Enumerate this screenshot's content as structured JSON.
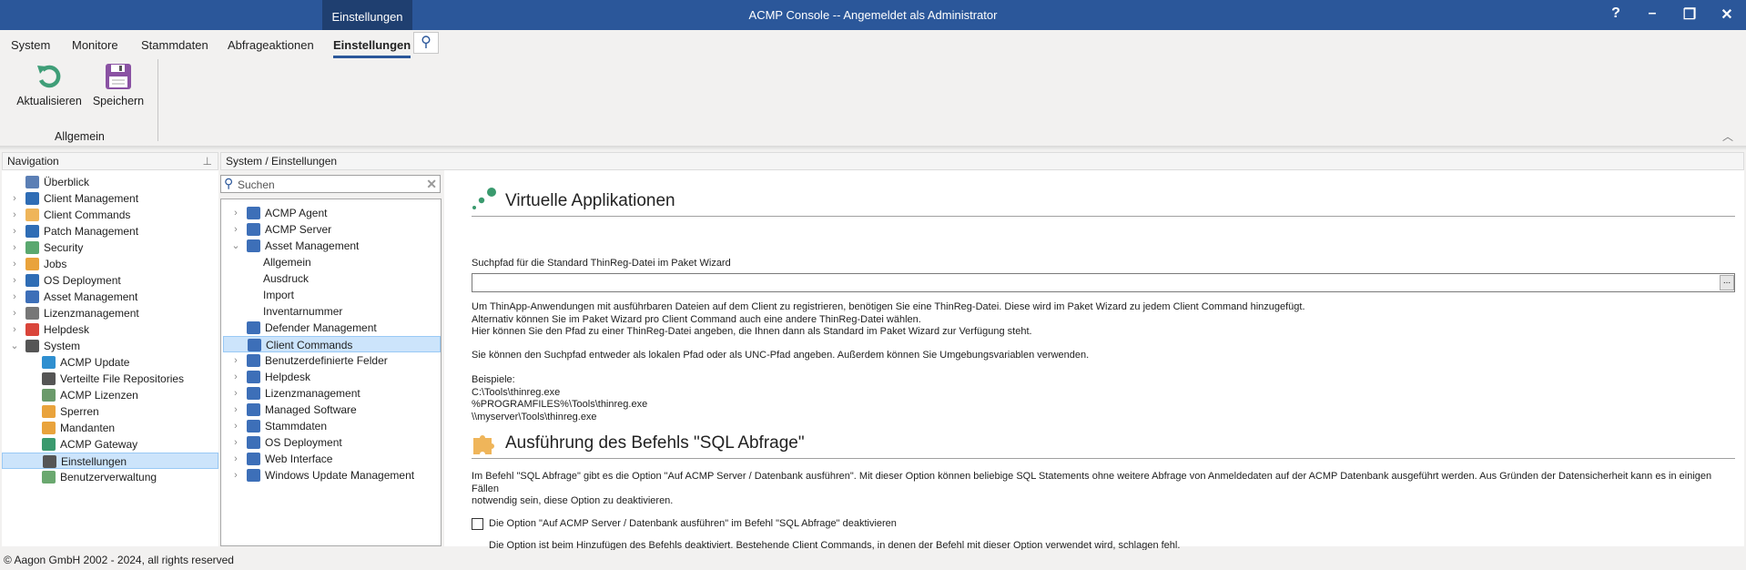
{
  "titlebar": {
    "context_tab": "Einstellungen",
    "title": "ACMP Console -- Angemeldet als Administrator",
    "help": "?",
    "minimize": "–",
    "restore": "❐",
    "close": "✕"
  },
  "ribbon": {
    "tabs": [
      "System",
      "Monitore",
      "Stammdaten",
      "Abfrageaktionen",
      "Einstellungen"
    ],
    "active_tab": "Einstellungen",
    "buttons": {
      "refresh": "Aktualisieren",
      "save": "Speichern"
    },
    "group": "Allgemein"
  },
  "navigation": {
    "title": "Navigation",
    "items": [
      {
        "label": "Überblick",
        "icon": "overview-icon",
        "expandable": false
      },
      {
        "label": "Client Management",
        "icon": "monitor-icon",
        "expandable": true
      },
      {
        "label": "Client Commands",
        "icon": "puzzle-icon",
        "expandable": true
      },
      {
        "label": "Patch Management",
        "icon": "patch-icon",
        "expandable": true
      },
      {
        "label": "Security",
        "icon": "shield-icon",
        "expandable": true
      },
      {
        "label": "Jobs",
        "icon": "clipboard-icon",
        "expandable": true
      },
      {
        "label": "OS Deployment",
        "icon": "deploy-icon",
        "expandable": true
      },
      {
        "label": "Asset Management",
        "icon": "asset-icon",
        "expandable": true
      },
      {
        "label": "Lizenzmanagement",
        "icon": "license-icon",
        "expandable": true
      },
      {
        "label": "Helpdesk",
        "icon": "tag-icon",
        "expandable": true
      },
      {
        "label": "System",
        "icon": "server-icon",
        "expandable": true,
        "expanded": true
      },
      {
        "label": "ACMP Update",
        "icon": "update-icon",
        "child": true
      },
      {
        "label": "Verteilte File Repositories",
        "icon": "repository-icon",
        "child": true
      },
      {
        "label": "ACMP Lizenzen",
        "icon": "certificate-icon",
        "child": true
      },
      {
        "label": "Sperren",
        "icon": "lock-icon",
        "child": true
      },
      {
        "label": "Mandanten",
        "icon": "tenant-icon",
        "child": true
      },
      {
        "label": "ACMP Gateway",
        "icon": "gateway-icon",
        "child": true
      },
      {
        "label": "Einstellungen",
        "icon": "tools-icon",
        "child": true,
        "selected": true
      },
      {
        "label": "Benutzerverwaltung",
        "icon": "users-icon",
        "child": true
      }
    ]
  },
  "settings_tree": {
    "title": "System / Einstellungen",
    "search_placeholder": "Suchen",
    "items": [
      {
        "label": "ACMP Agent",
        "expandable": true
      },
      {
        "label": "ACMP Server",
        "expandable": true
      },
      {
        "label": "Asset Management",
        "expandable": true,
        "expanded": true
      },
      {
        "label": "Allgemein",
        "child": true
      },
      {
        "label": "Ausdruck",
        "child": true
      },
      {
        "label": "Import",
        "child": true
      },
      {
        "label": "Inventarnummer",
        "child": true
      },
      {
        "label": "Defender Management",
        "expandable": false
      },
      {
        "label": "Client Commands",
        "expandable": false,
        "selected": true
      },
      {
        "label": "Benutzerdefinierte Felder",
        "expandable": true
      },
      {
        "label": "Helpdesk",
        "expandable": true
      },
      {
        "label": "Lizenzmanagement",
        "expandable": true
      },
      {
        "label": "Managed Software",
        "expandable": true
      },
      {
        "label": "Stammdaten",
        "expandable": true
      },
      {
        "label": "OS Deployment",
        "expandable": true
      },
      {
        "label": "Web Interface",
        "expandable": true
      },
      {
        "label": "Windows Update Management",
        "expandable": true
      }
    ]
  },
  "content": {
    "virtual": {
      "heading": "Virtuelle Applikationen",
      "field_label": "Suchpfad für die Standard ThinReg-Datei im Paket Wizard",
      "field_value": "",
      "browse": "...",
      "p1": "Um ThinApp-Anwendungen mit ausführbaren Dateien auf dem Client zu registrieren, benötigen Sie eine ThinReg-Datei. Diese wird im Paket Wizard zu jedem Client Command hinzugefügt.",
      "p2": "Alternativ können Sie im Paket Wizard pro Client Command auch eine andere ThinReg-Datei wählen.",
      "p3": "Hier können Sie den Pfad zu einer ThinReg-Datei angeben, die Ihnen dann als Standard im Paket Wizard zur Verfügung steht.",
      "p4": "Sie können den Suchpfad entweder als lokalen Pfad oder als UNC-Pfad angeben. Außerdem können Sie Umgebungsvariablen verwenden.",
      "examples_label": "Beispiele:",
      "examples": [
        "C:\\Tools\\thinreg.exe",
        "%PROGRAMFILES%\\Tools\\thinreg.exe",
        "\\\\myserver\\Tools\\thinreg.exe"
      ]
    },
    "sql": {
      "heading": "Ausführung des Befehls \"SQL Abfrage\"",
      "p1": "Im Befehl \"SQL Abfrage\" gibt es die Option \"Auf ACMP Server / Datenbank ausführen\". Mit dieser Option können beliebige SQL Statements ohne weitere Abfrage von Anmeldedaten auf der ACMP Datenbank ausgeführt werden. Aus Gründen der Datensicherheit kann es in einigen Fällen",
      "p2": "notwendig sein, diese Option zu deaktivieren.",
      "checkbox_label": "Die Option \"Auf ACMP Server / Datenbank ausführen\" im Befehl \"SQL Abfrage\" deaktivieren",
      "checkbox_checked": false,
      "note": "Die Option ist beim Hinzufügen des Befehls deaktiviert. Bestehende Client Commands, in denen der Befehl mit dieser Option verwendet wird, schlagen fehl."
    }
  },
  "status": "© Aagon GmbH 2002 - 2024, all rights reserved",
  "colors": {
    "titlebar": "#2b579a",
    "selection": "#cce4fb",
    "accent_green": "#3a9a6e"
  }
}
